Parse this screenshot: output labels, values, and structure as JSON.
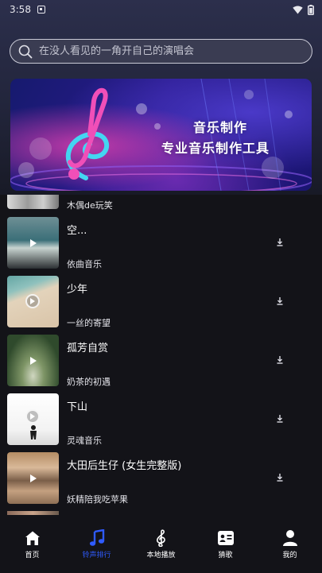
{
  "status_bar": {
    "time": "3:58",
    "icons": [
      "notification-icon",
      "wifi-icon",
      "battery-icon"
    ]
  },
  "search": {
    "placeholder": "在没人看见的一角开自己的演唱会"
  },
  "banner": {
    "line1": "音乐制作",
    "line2": "专业音乐制作工具"
  },
  "songs": {
    "partial_top_artist": "木偶de玩笑",
    "items": [
      {
        "title": "空...",
        "artist": "依曲音乐",
        "thumb_colors": [
          "#3b6f78",
          "#b8c6c4",
          "#3a3d40"
        ]
      },
      {
        "title": "少年",
        "artist": "一丝的寄望",
        "thumb_colors": [
          "#d9c4a8",
          "#64a6a4",
          "#c9b394"
        ]
      },
      {
        "title": "孤芳自赏",
        "artist": "奶茶的初遇",
        "thumb_colors": [
          "#2f4a2c",
          "#7e9566",
          "#cfd6c0"
        ]
      },
      {
        "title": "下山",
        "artist": "灵魂音乐",
        "thumb_colors": [
          "#ffffff",
          "#f1f1f1",
          "#dcdcdc"
        ]
      },
      {
        "title": "大田后生仔 (女生完整版)",
        "artist": "妖精陪我吃苹果",
        "thumb_colors": [
          "#b48c64",
          "#7a5e48",
          "#d9b999"
        ]
      }
    ]
  },
  "nav": {
    "items": [
      {
        "label": "首页",
        "icon": "home-icon",
        "active": false
      },
      {
        "label": "铃声排行",
        "icon": "music-note-icon",
        "active": true
      },
      {
        "label": "本地播放",
        "icon": "treble-clef-icon",
        "active": false
      },
      {
        "label": "猜歌",
        "icon": "quiz-card-icon",
        "active": false
      },
      {
        "label": "我的",
        "icon": "user-icon",
        "active": false
      }
    ]
  },
  "colors": {
    "accent": "#2f5bff",
    "background": "#131318",
    "header_gradient_top": "#2c2f4c"
  }
}
